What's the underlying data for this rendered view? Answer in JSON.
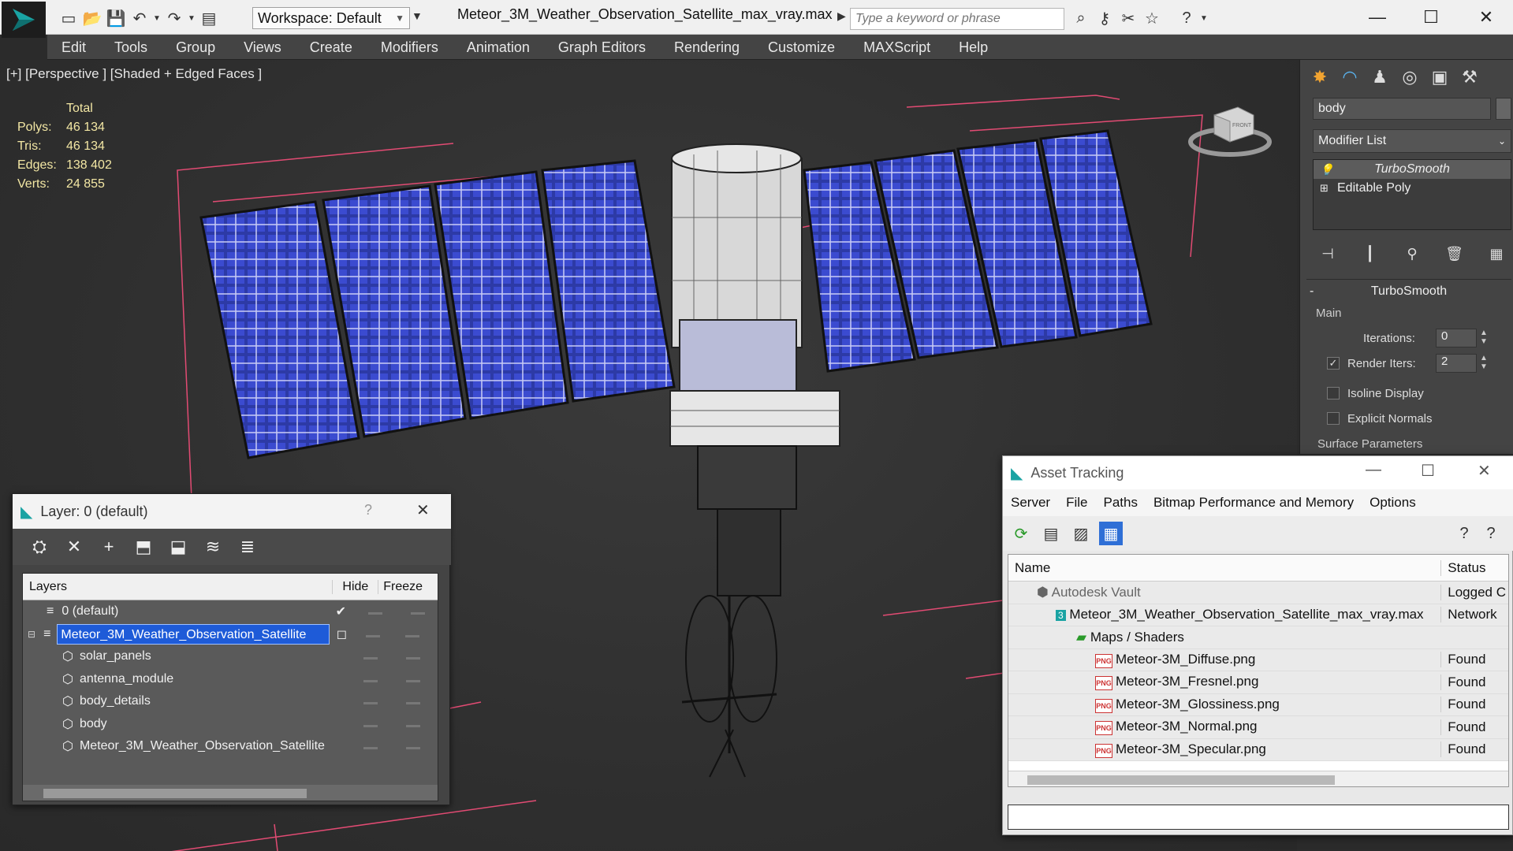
{
  "titlebar": {
    "workspace_label": "Workspace: Default",
    "file_title": "Meteor_3M_Weather_Observation_Satellite_max_vray.max",
    "search_placeholder": "Type a keyword or phrase"
  },
  "menubar": {
    "items": [
      "Edit",
      "Tools",
      "Group",
      "Views",
      "Create",
      "Modifiers",
      "Animation",
      "Graph Editors",
      "Rendering",
      "Customize",
      "MAXScript",
      "Help"
    ]
  },
  "viewport": {
    "label": "[+] [Perspective ] [Shaded + Edged Faces ]",
    "stats": {
      "total_label": "Total",
      "polys_label": "Polys:",
      "polys": "46 134",
      "tris_label": "Tris:",
      "tris": "46 134",
      "edges_label": "Edges:",
      "edges": "138 402",
      "verts_label": "Verts:",
      "verts": "24 855"
    },
    "viewcube_text": "FRONT"
  },
  "command_panel": {
    "object_name": "body",
    "modifier_list": "Modifier List",
    "stack": [
      "TurboSmooth",
      "Editable Poly"
    ],
    "rollout_title": "TurboSmooth",
    "main_label": "Main",
    "iterations_label": "Iterations:",
    "iterations": "0",
    "render_iters_label": "Render Iters:",
    "render_iters": "2",
    "isoline_label": "Isoline Display",
    "explicit_normals_label": "Explicit Normals",
    "surface_params_label": "Surface Parameters"
  },
  "layer_window": {
    "title": "Layer: 0 (default)",
    "help": "?",
    "col_layers": "Layers",
    "col_hide": "Hide",
    "col_freeze": "Freeze",
    "rows": [
      {
        "name": "0 (default)",
        "level": 0
      },
      {
        "name": "Meteor_3M_Weather_Observation_Satellite",
        "level": 0
      },
      {
        "name": "solar_panels",
        "level": 1
      },
      {
        "name": "antenna_module",
        "level": 1
      },
      {
        "name": "body_details",
        "level": 1
      },
      {
        "name": "body",
        "level": 1
      },
      {
        "name": "Meteor_3M_Weather_Observation_Satellite",
        "level": 1
      }
    ]
  },
  "asset_window": {
    "title": "Asset Tracking",
    "menu": [
      "Server",
      "File",
      "Paths",
      "Bitmap Performance and Memory",
      "Options"
    ],
    "col_name": "Name",
    "col_status": "Status",
    "rows": [
      {
        "name": "Autodesk Vault",
        "status": "Logged C"
      },
      {
        "name": "Meteor_3M_Weather_Observation_Satellite_max_vray.max",
        "status": "Network"
      },
      {
        "name": "Maps / Shaders",
        "status": ""
      },
      {
        "name": "Meteor-3M_Diffuse.png",
        "status": "Found"
      },
      {
        "name": "Meteor-3M_Fresnel.png",
        "status": "Found"
      },
      {
        "name": "Meteor-3M_Glossiness.png",
        "status": "Found"
      },
      {
        "name": "Meteor-3M_Normal.png",
        "status": "Found"
      },
      {
        "name": "Meteor-3M_Specular.png",
        "status": "Found"
      }
    ]
  },
  "colors": {
    "selection_blue": "#1e5bd8",
    "stats_yellow": "#f3e7a4",
    "panel_blue": "#2d3aa6",
    "wire_red": "#e24b73"
  }
}
